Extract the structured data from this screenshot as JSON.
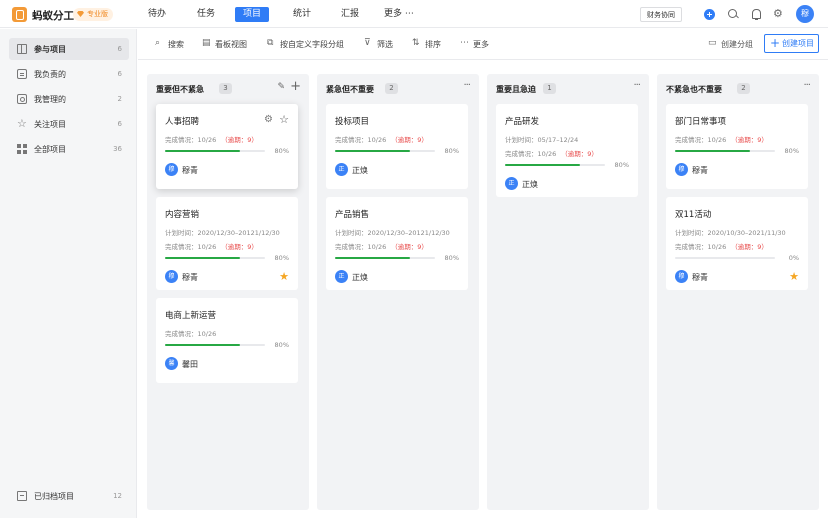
{
  "app": {
    "name": "蚂蚁分工",
    "badge": "专业版"
  },
  "nav": {
    "items": [
      "待办",
      "任务",
      "项目",
      "统计",
      "汇报",
      "更多"
    ],
    "active": 2
  },
  "header": {
    "collab_button": "财务协同",
    "user_initial": "穆"
  },
  "sidebar": {
    "items": [
      {
        "label": "参与项目",
        "count": "6",
        "active": true,
        "icon": "project-icon"
      },
      {
        "label": "我负责的",
        "count": "6",
        "icon": "doc-icon"
      },
      {
        "label": "我管理的",
        "count": "2",
        "icon": "person-icon"
      },
      {
        "label": "关注项目",
        "count": "6",
        "icon": "star-icon"
      },
      {
        "label": "全部项目",
        "count": "36",
        "icon": "grid-icon"
      }
    ],
    "archived": {
      "label": "已归档项目",
      "count": "12",
      "icon": "archive-icon"
    }
  },
  "toolbar": {
    "search": "搜索",
    "board_view": "看板视图",
    "group_by": "按自定义字段分组",
    "filter": "筛选",
    "sort": "排序",
    "more": "更多",
    "create_group": "创建分组",
    "create_project": "创建项目"
  },
  "accent_color": "#2f7cf6",
  "progress_color": "#27a844",
  "overdue_color": "#e84b4b",
  "columns": [
    {
      "title": "重要但不紧急",
      "count": "3",
      "cards": [
        {
          "title": "人事招聘",
          "progress_label": "完成情况：",
          "progress_text": "10/26",
          "overdue": "（逾期：9）",
          "progress": 0.75,
          "pct": "80%",
          "owner_initial": "穆",
          "owner": "穆青",
          "hover": true
        },
        {
          "title": "内容营销",
          "plan_label": "计划时间：",
          "plan": "2020/12/30–20121/12/30",
          "progress_label": "完成情况：",
          "progress_text": "10/26",
          "overdue": "（逾期：9）",
          "progress": 0.75,
          "pct": "80%",
          "owner_initial": "穆",
          "owner": "穆青",
          "starred": true
        },
        {
          "title": "电商上新运营",
          "progress_label": "完成情况：",
          "progress_text": "10/26",
          "progress": 0.75,
          "pct": "80%",
          "owner_initial": "馨",
          "owner": "馨田"
        }
      ]
    },
    {
      "title": "紧急但不重要",
      "count": "2",
      "cards": [
        {
          "title": "投标项目",
          "progress_label": "完成情况：",
          "progress_text": "10/26",
          "overdue": "（逾期：9）",
          "progress": 0.75,
          "pct": "80%",
          "owner_initial": "正",
          "owner": "正焕"
        },
        {
          "title": "产品销售",
          "plan_label": "计划时间：",
          "plan": "2020/12/30–20121/12/30",
          "progress_label": "完成情况：",
          "progress_text": "10/26",
          "overdue": "（逾期：9）",
          "progress": 0.75,
          "pct": "80%",
          "owner_initial": "正",
          "owner": "正焕"
        }
      ]
    },
    {
      "title": "重要且急迫",
      "count": "1",
      "cards": [
        {
          "title": "产品研发",
          "plan_label": "计划时间：",
          "plan": "05/17–12/24",
          "progress_label": "完成情况：",
          "progress_text": "10/26",
          "overdue": "（逾期：9）",
          "progress": 0.75,
          "pct": "80%",
          "owner_initial": "正",
          "owner": "正焕"
        }
      ]
    },
    {
      "title": "不紧急也不重要",
      "count": "2",
      "cards": [
        {
          "title": "部门日常事项",
          "progress_label": "完成情况：",
          "progress_text": "10/26",
          "overdue": "（逾期：9）",
          "progress": 0.75,
          "pct": "80%",
          "owner_initial": "穆",
          "owner": "穆青"
        },
        {
          "title": "双11活动",
          "plan_label": "计划时间：",
          "plan": "2020/10/30–2021/11/30",
          "progress_label": "完成情况：",
          "progress_text": "10/26",
          "overdue": "（逾期：9）",
          "progress": 0,
          "pct": "0%",
          "owner_initial": "穆",
          "owner": "穆青",
          "starred": true
        }
      ]
    }
  ]
}
